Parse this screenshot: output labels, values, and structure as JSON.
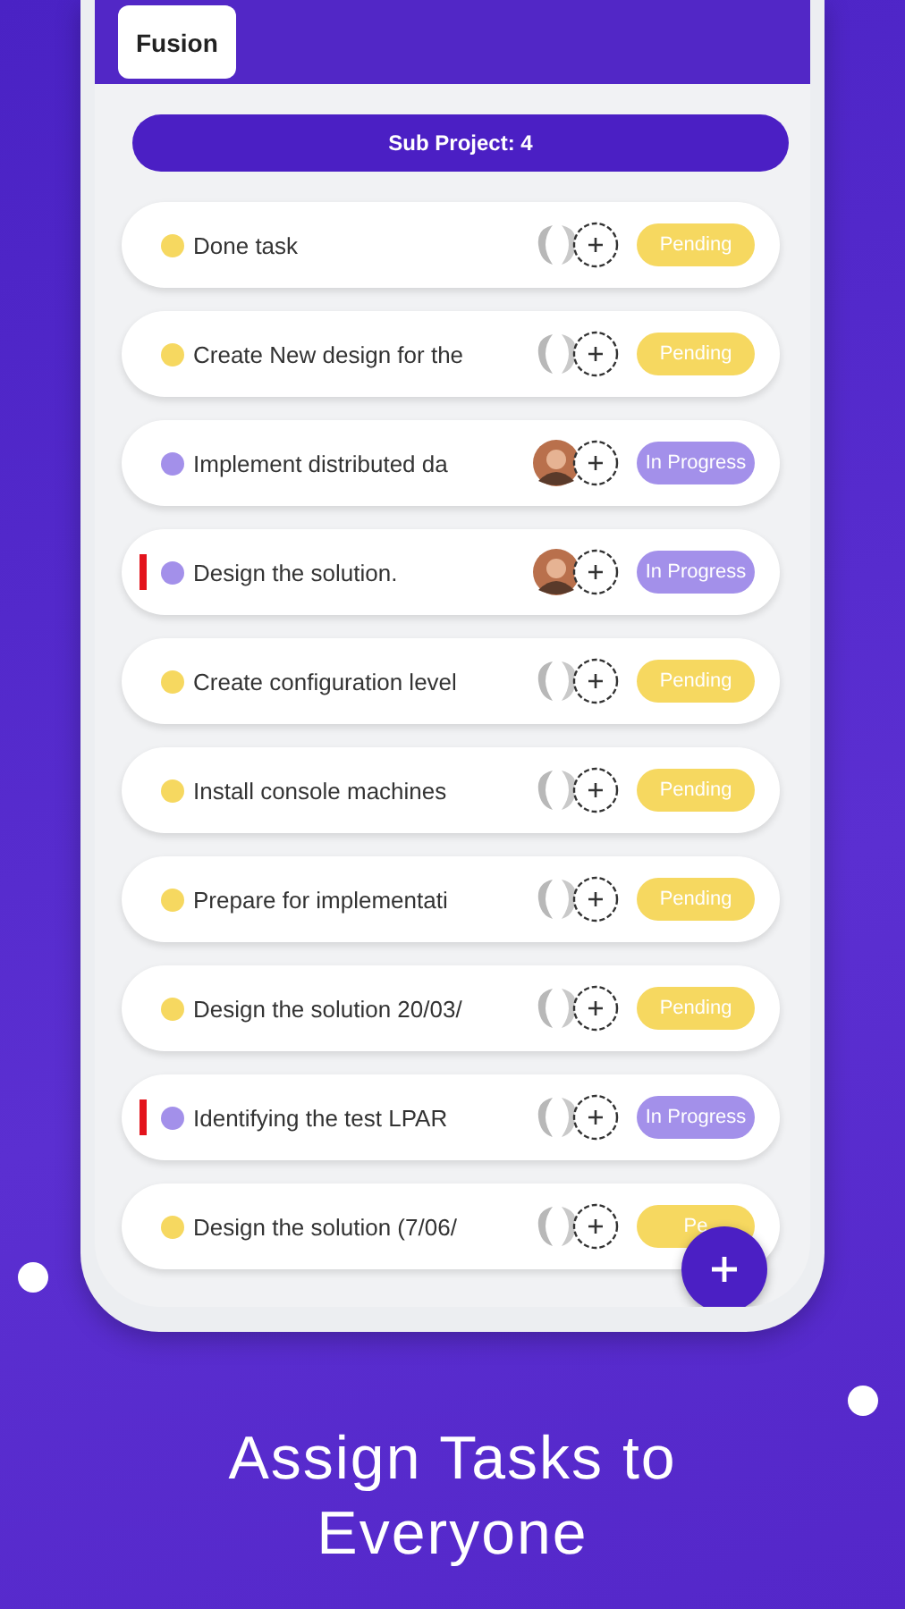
{
  "header": {
    "project_button": "Fusion"
  },
  "sub_project": "Sub Project: 4",
  "tasks": [
    {
      "title": "Done task",
      "kind": "pending",
      "badge": "Pending",
      "flagged": false,
      "has_photo": false
    },
    {
      "title": "Create New design for the",
      "kind": "pending",
      "badge": "Pending",
      "flagged": false,
      "has_photo": false
    },
    {
      "title": "Implement distributed da",
      "kind": "progress",
      "badge": "In Progress",
      "flagged": false,
      "has_photo": true
    },
    {
      "title": "Design the solution.",
      "kind": "progress",
      "badge": "In Progress",
      "flagged": true,
      "has_photo": true
    },
    {
      "title": "Create configuration level",
      "kind": "pending",
      "badge": "Pending",
      "flagged": false,
      "has_photo": false
    },
    {
      "title": "Install console machines",
      "kind": "pending",
      "badge": "Pending",
      "flagged": false,
      "has_photo": false
    },
    {
      "title": "Prepare for implementati",
      "kind": "pending",
      "badge": "Pending",
      "flagged": false,
      "has_photo": false
    },
    {
      "title": "Design the solution 20/03/",
      "kind": "pending",
      "badge": "Pending",
      "flagged": false,
      "has_photo": false
    },
    {
      "title": "Identifying the test LPAR",
      "kind": "progress",
      "badge": "In Progress",
      "flagged": true,
      "has_photo": false
    },
    {
      "title": "Design the solution (7/06/",
      "kind": "pending",
      "badge": "Pe",
      "flagged": false,
      "has_photo": false
    }
  ],
  "caption": [
    "Assign Tasks to",
    "Everyone"
  ]
}
